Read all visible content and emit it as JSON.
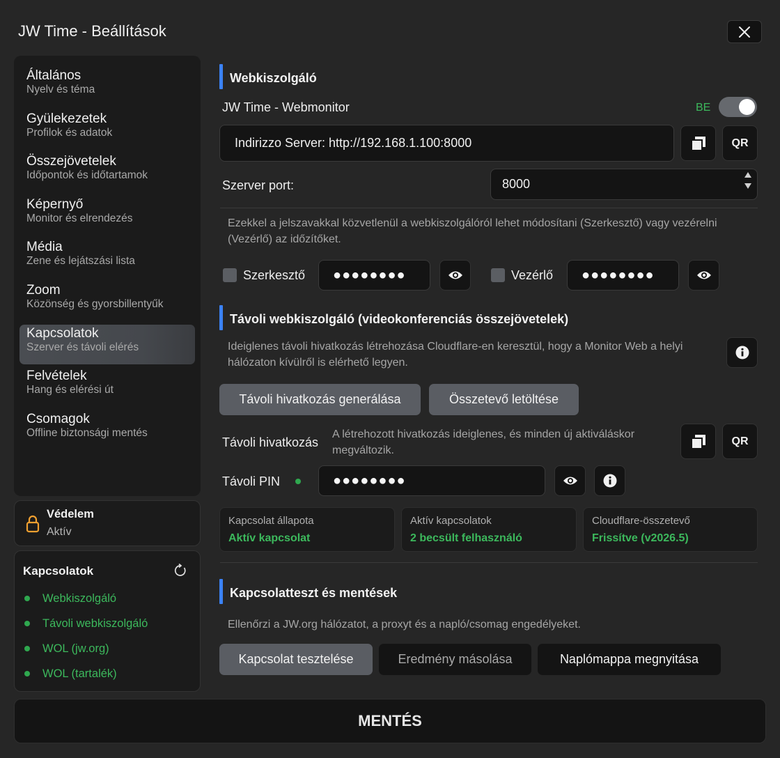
{
  "window": {
    "title": "JW Time - Beállítások"
  },
  "sidebar": {
    "items": [
      {
        "label": "Általános",
        "sub": "Nyelv és téma"
      },
      {
        "label": "Gyülekezetek",
        "sub": "Profilok és adatok"
      },
      {
        "label": "Összejövetelek",
        "sub": "Időpontok és időtartamok"
      },
      {
        "label": "Képernyő",
        "sub": "Monitor és elrendezés"
      },
      {
        "label": "Média",
        "sub": "Zene és lejátszási lista"
      },
      {
        "label": "Zoom",
        "sub": "Közönség és gyorsbillentyűk"
      },
      {
        "label": "Kapcsolatok",
        "sub": "Szerver és távoli elérés"
      },
      {
        "label": "Felvételek",
        "sub": "Hang és elérési út"
      },
      {
        "label": "Csomagok",
        "sub": "Offline biztonsági mentés"
      }
    ],
    "active_index": 6
  },
  "protection": {
    "title": "Védelem",
    "status": "Aktív"
  },
  "status_panel": {
    "title": "Kapcsolatok",
    "items": [
      "Webkiszolgáló",
      "Távoli webkiszolgáló",
      "WOL (jw.org)",
      "WOL (tartalék)"
    ]
  },
  "webserver": {
    "section_title": "Webkiszolgáló",
    "monitor_label": "JW Time - Webmonitor",
    "toggle_state": "BE",
    "address": "Indirizzo Server: http://192.168.1.100:8000",
    "qr_label": "QR",
    "port_label": "Szerver port:",
    "port_value": "8000",
    "password_note": "Ezekkel a jelszavakkal közvetlenül a webkiszolgálóról lehet módosítani (Szerkesztő) vagy vezérelni (Vezérlő) az időzítőket.",
    "editor_label": "Szerkesztő",
    "editor_password": "●●●●●●●●",
    "controller_label": "Vezérlő",
    "controller_password": "●●●●●●●●"
  },
  "remote": {
    "section_title": "Távoli webkiszolgáló (videokonferenciás összejövetelek)",
    "description": "Ideiglenes távoli hivatkozás létrehozása Cloudflare-en keresztül, hogy a Monitor Web a helyi hálózaton kívülről is elérhető legyen.",
    "generate_button": "Távoli hivatkozás generálása",
    "download_button": "Összetevő letöltése",
    "link_label": "Távoli hivatkozás",
    "link_note": "A létrehozott hivatkozás ideiglenes, és minden új aktiváláskor megváltozik.",
    "qr_label": "QR",
    "pin_label": "Távoli PIN",
    "pin_value": "●●●●●●●●",
    "cards": [
      {
        "label": "Kapcsolat állapota",
        "value": "Aktív kapcsolat"
      },
      {
        "label": "Aktív kapcsolatok",
        "value": "2 becsült felhasználó"
      },
      {
        "label": "Cloudflare-összetevő",
        "value": "Frissítve (v2026.5)"
      }
    ]
  },
  "test": {
    "section_title": "Kapcsolatteszt és mentések",
    "description": "Ellenőrzi a JW.org hálózatot, a proxyt és a napló/csomag engedélyeket.",
    "test_button": "Kapcsolat tesztelése",
    "copy_button": "Eredmény másolása",
    "open_button": "Naplómappa megnyitása"
  },
  "save_button": "MENTÉS",
  "colors": {
    "accent": "#3b82f6",
    "success": "#3cb85c",
    "background": "#262626"
  }
}
